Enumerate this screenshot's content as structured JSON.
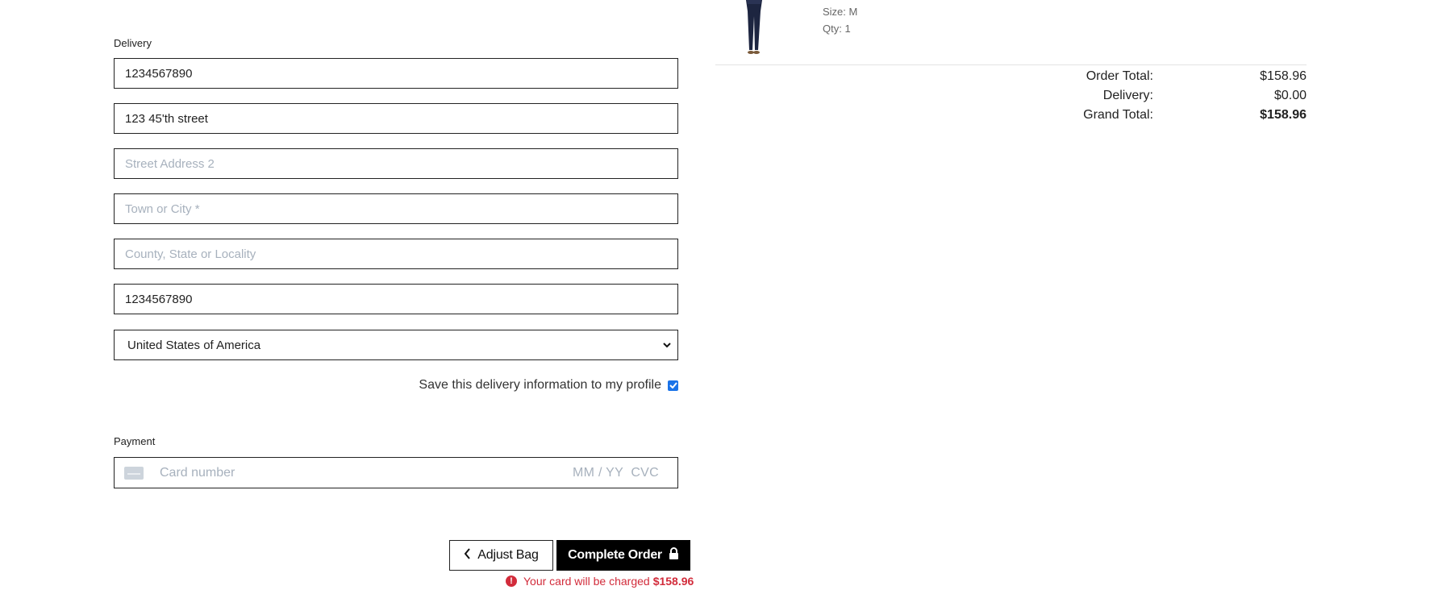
{
  "delivery": {
    "label": "Delivery",
    "fields": [
      {
        "value": "1234567890",
        "placeholder": ""
      },
      {
        "value": "123 45'th street",
        "placeholder": ""
      },
      {
        "value": "",
        "placeholder": "Street Address 2"
      },
      {
        "value": "",
        "placeholder": "Town or City *"
      },
      {
        "value": "",
        "placeholder": "County, State or Locality"
      },
      {
        "value": "1234567890",
        "placeholder": ""
      }
    ],
    "country": {
      "selected": "United States of America"
    },
    "save_label": "Save this delivery information to my profile",
    "save_checked": true
  },
  "payment": {
    "label": "Payment",
    "card_placeholder": "Card number",
    "expiry_cvc_placeholder": "MM / YY  CVC"
  },
  "actions": {
    "adjust_label": "Adjust Bag",
    "complete_label": "Complete Order",
    "charge_note": "Your card will be charged",
    "charge_amount": "$158.96"
  },
  "product": {
    "size": "Size: M",
    "qty": "Qty: 1"
  },
  "summary": {
    "order_total_label": "Order Total:",
    "order_total": "$158.96",
    "delivery_label": "Delivery:",
    "delivery": "$0.00",
    "grand_total_label": "Grand Total:",
    "grand_total": "$158.96"
  },
  "colors": {
    "error": "#d22c3b",
    "placeholder": "#a7b1bd",
    "checkbox": "#1a73e8"
  }
}
